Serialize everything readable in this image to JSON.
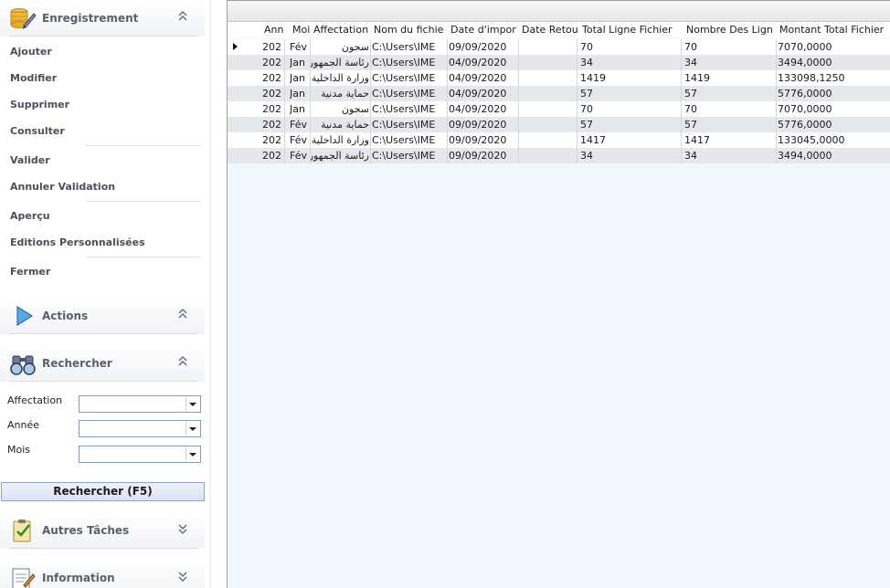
{
  "sidebar": {
    "sections": {
      "enregistrement": "Enregistrement",
      "actions": "Actions",
      "rechercher": "Rechercher",
      "autres_taches": "Autres Tâches",
      "information": "Information"
    },
    "menu": {
      "ajouter": "Ajouter",
      "modifier": "Modifier",
      "supprimer": "Supprimer",
      "consulter": "Consulter",
      "valider": "Valider",
      "annuler_validation": "Annuler Validation",
      "apercu": "Aperçu",
      "editions": "Editions Personnalisées",
      "fermer": "Fermer"
    },
    "search": {
      "affectation_label": "Affectation",
      "annee_label": "Année",
      "mois_label": "Mois",
      "affectation_value": "",
      "annee_value": "",
      "mois_value": "",
      "button_label": "Rechercher (F5)"
    }
  },
  "grid": {
    "columns": {
      "annee": "Ann",
      "mois": "Moi",
      "affectation": "Affectation",
      "nom_fichier": "Nom du fichie",
      "date_import": "Date d'impor",
      "date_retour": "Date Retou",
      "total_ligne": "Total Ligne Fichier",
      "nombre_lignes": "Nombre Des Lign",
      "montant_total": "Montant Total Fichier"
    },
    "rows": [
      {
        "annee": "202",
        "mois": "Fév",
        "affectation": "سجون",
        "nom_fichier": "C:\\Users\\IME",
        "date_import": "09/09/2020",
        "date_retour": "",
        "total_ligne": "70",
        "nombre_lignes": "70",
        "montant_total": "7070,0000"
      },
      {
        "annee": "202",
        "mois": "Jan",
        "affectation": "رئاسة الجمهورية",
        "nom_fichier": "C:\\Users\\IME",
        "date_import": "04/09/2020",
        "date_retour": "",
        "total_ligne": "34",
        "nombre_lignes": "34",
        "montant_total": "3494,0000"
      },
      {
        "annee": "202",
        "mois": "Jan",
        "affectation": "وزارة الداخلية",
        "nom_fichier": "C:\\Users\\IME",
        "date_import": "04/09/2020",
        "date_retour": "",
        "total_ligne": "1419",
        "nombre_lignes": "1419",
        "montant_total": "133098,1250"
      },
      {
        "annee": "202",
        "mois": "Jan",
        "affectation": "حماية مدنية",
        "nom_fichier": "C:\\Users\\IME",
        "date_import": "04/09/2020",
        "date_retour": "",
        "total_ligne": "57",
        "nombre_lignes": "57",
        "montant_total": "5776,0000"
      },
      {
        "annee": "202",
        "mois": "Jan",
        "affectation": "سجون",
        "nom_fichier": "C:\\Users\\IME",
        "date_import": "04/09/2020",
        "date_retour": "",
        "total_ligne": "70",
        "nombre_lignes": "70",
        "montant_total": "7070,0000"
      },
      {
        "annee": "202",
        "mois": "Fév",
        "affectation": "حماية مدنية",
        "nom_fichier": "C:\\Users\\IME",
        "date_import": "09/09/2020",
        "date_retour": "",
        "total_ligne": "57",
        "nombre_lignes": "57",
        "montant_total": "5776,0000"
      },
      {
        "annee": "202",
        "mois": "Fév",
        "affectation": "وزارة الداخلية",
        "nom_fichier": "C:\\Users\\IME",
        "date_import": "09/09/2020",
        "date_retour": "",
        "total_ligne": "1417",
        "nombre_lignes": "1417",
        "montant_total": "133045,0000"
      },
      {
        "annee": "202",
        "mois": "Fév",
        "affectation": "رئاسة الجمهورية",
        "nom_fichier": "C:\\Users\\IME",
        "date_import": "09/09/2020",
        "date_retour": "",
        "total_ligne": "34",
        "nombre_lignes": "34",
        "montant_total": "3494,0000"
      }
    ]
  },
  "icons": {
    "enregistrement": "database-pencil-icon",
    "actions": "play-arrow-icon",
    "rechercher": "binoculars-icon",
    "autres_taches": "checklist-icon",
    "information": "info-document-icon",
    "expand": "double-chevron-icon",
    "row_indicator": "current-row-arrow-icon"
  },
  "colors": {
    "grid_background": "#f0f7ff",
    "row_alternate": "#e6e7ea",
    "section_text": "#5b6068",
    "button_border": "#8ea3c6"
  }
}
